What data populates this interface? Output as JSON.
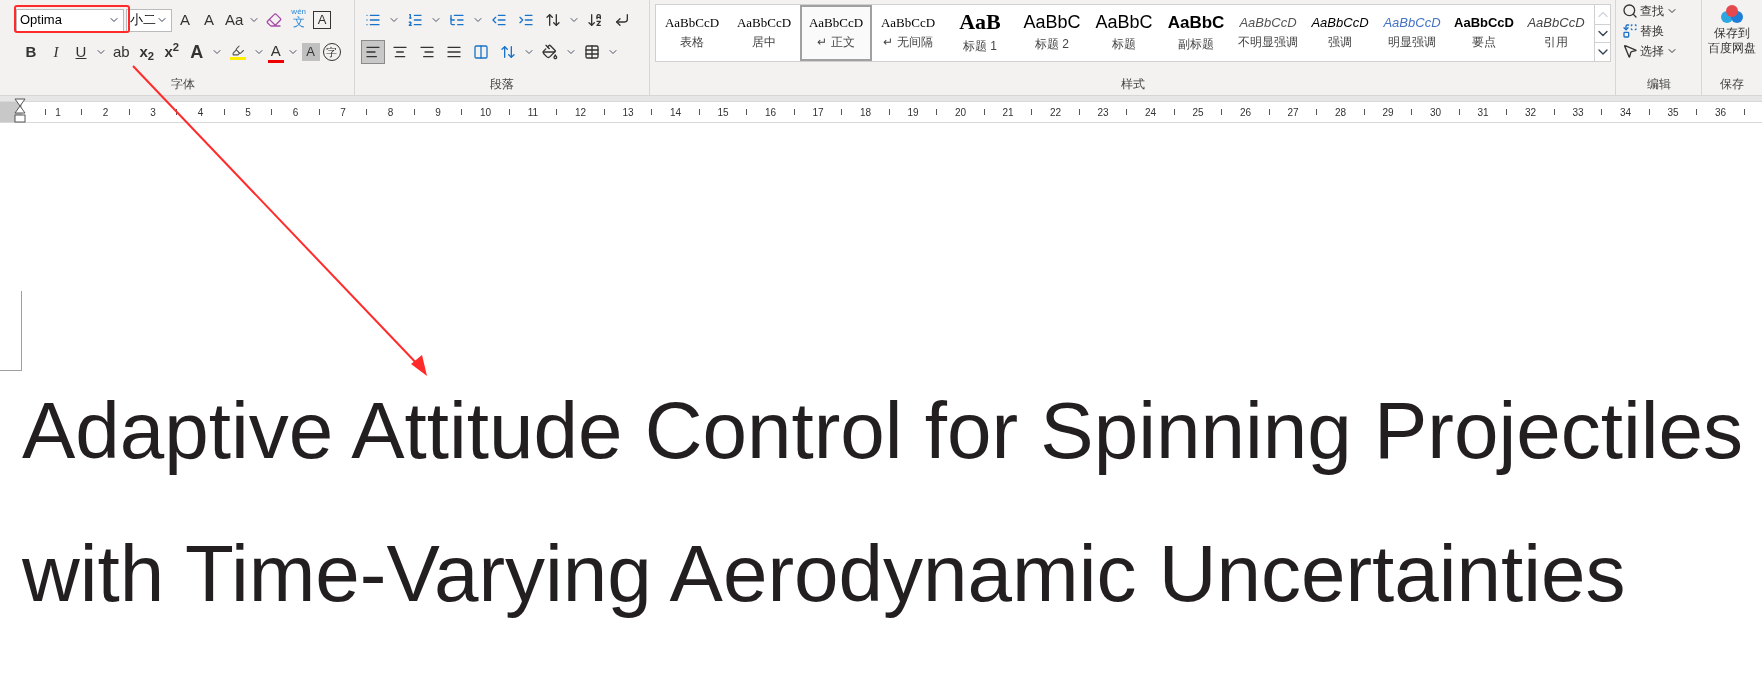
{
  "font": {
    "name": "Optima",
    "size": "小二",
    "group_label": "字体",
    "glyphs": {
      "grow": "A",
      "shrink": "A",
      "case": "Aa",
      "phonetic_top": "wén",
      "phonetic": "文",
      "border": "A",
      "bold": "B",
      "italic": "I",
      "underline": "U",
      "strike": "ab",
      "sub": "x$_{2}$",
      "sup": "x$^{2}$",
      "effects": "A",
      "letter_a": "A",
      "shade": "A",
      "enclose": "字"
    }
  },
  "paragraph": {
    "group_label": "段落",
    "align_buttons": [
      {
        "selected": true
      },
      {
        "selected": false
      },
      {
        "selected": false
      },
      {
        "selected": false
      },
      {
        "selected": false
      }
    ]
  },
  "styles": {
    "group_label": "样式",
    "items": [
      {
        "preview": "AaBbCcD",
        "label": "表格",
        "kind": "serif",
        "selected": false
      },
      {
        "preview": "AaBbCcD",
        "label": "居中",
        "kind": "serif",
        "selected": false
      },
      {
        "preview": "AaBbCcD",
        "label": "↵ 正文",
        "kind": "serif",
        "selected": true
      },
      {
        "preview": "AaBbCcD",
        "label": "↵ 无间隔",
        "kind": "serif",
        "selected": false
      },
      {
        "preview": "AaB",
        "label": "标题 1",
        "kind": "heading",
        "selected": false
      },
      {
        "preview": "AaBbC",
        "label": "标题 2",
        "kind": "sans_large",
        "selected": false
      },
      {
        "preview": "AaBbC",
        "label": "标题",
        "kind": "sans_large",
        "selected": false
      },
      {
        "preview": "AaBbC",
        "label": "副标题",
        "kind": "sans_bold",
        "selected": false
      },
      {
        "preview": "AaBbCcD",
        "label": "不明显强调",
        "kind": "italic_grey",
        "selected": false
      },
      {
        "preview": "AaBbCcD",
        "label": "强调",
        "kind": "italic",
        "selected": false
      },
      {
        "preview": "AaBbCcD",
        "label": "明显强调",
        "kind": "italic_blue",
        "selected": false
      },
      {
        "preview": "AaBbCcD",
        "label": "要点",
        "kind": "bold",
        "selected": false
      },
      {
        "preview": "AaBbCcD",
        "label": "引用",
        "kind": "italic_serif",
        "selected": false
      }
    ]
  },
  "editing": {
    "group_label": "编辑",
    "find": "查找",
    "replace": "替换",
    "select": "选择"
  },
  "save": {
    "group_label": "保存",
    "line1": "保存到",
    "line2": "百度网盘"
  },
  "ruler": [
    "1",
    "2",
    "3",
    "4",
    "5",
    "6",
    "7",
    "8",
    "9",
    "10",
    "11",
    "12",
    "13",
    "14",
    "15",
    "16",
    "17",
    "18",
    "19",
    "20",
    "21",
    "22",
    "23",
    "24",
    "25",
    "26",
    "27",
    "28",
    "29",
    "30",
    "31",
    "32",
    "33",
    "34",
    "35",
    "36"
  ],
  "document": {
    "title_lines": [
      "Adaptive Attitude Control for Spinning Projectiles",
      "with Time-Varying Aerodynamic Uncertainties"
    ]
  }
}
